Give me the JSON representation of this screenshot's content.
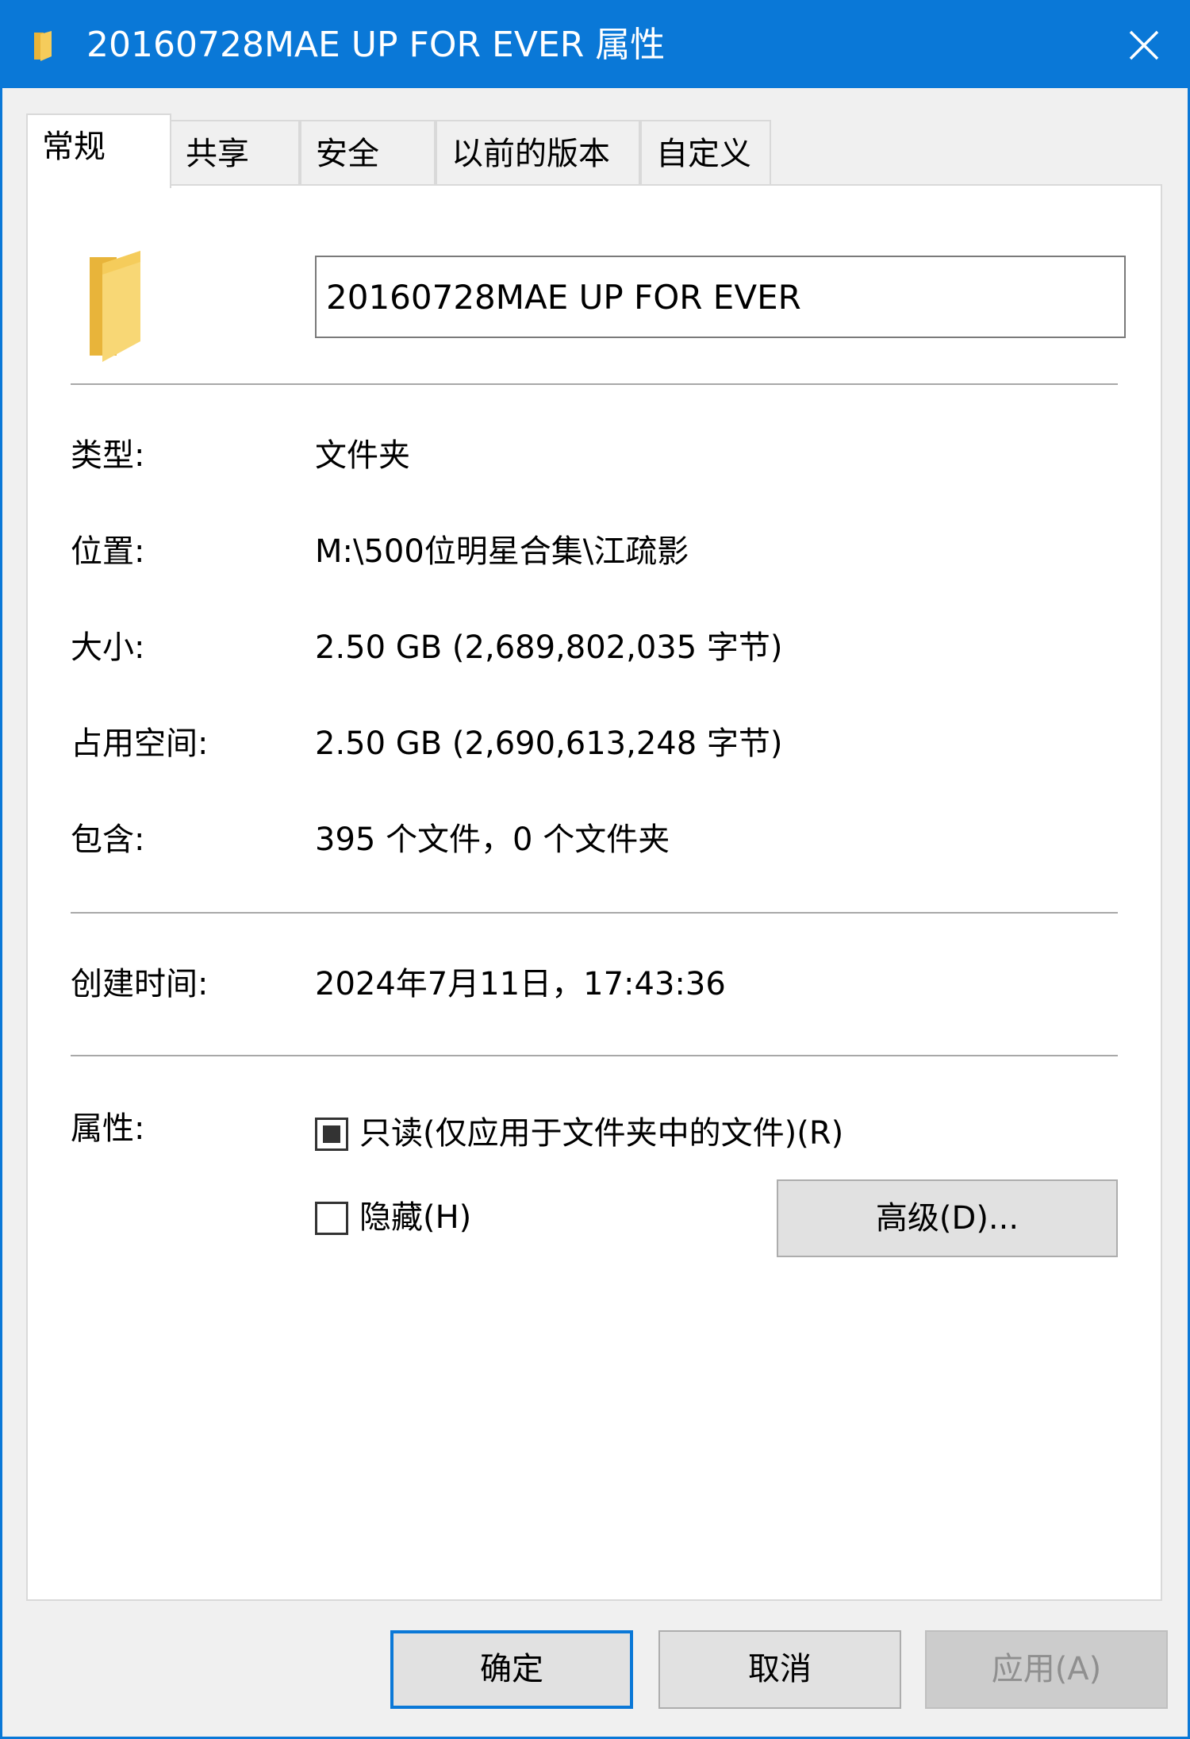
{
  "window": {
    "title": "20160728MAE UP FOR EVER 属性"
  },
  "tabs": [
    {
      "label": "常规",
      "active": true
    },
    {
      "label": "共享",
      "active": false
    },
    {
      "label": "安全",
      "active": false
    },
    {
      "label": "以前的版本",
      "active": false
    },
    {
      "label": "自定义",
      "active": false
    }
  ],
  "general": {
    "name_value": "20160728MAE UP FOR EVER",
    "rows": [
      {
        "label": "类型:",
        "value": "文件夹"
      },
      {
        "label": "位置:",
        "value": "M:\\500位明星合集\\江疏影"
      },
      {
        "label": "大小:",
        "value": "2.50 GB (2,689,802,035 字节)"
      },
      {
        "label": "占用空间:",
        "value": "2.50 GB (2,690,613,248 字节)"
      },
      {
        "label": "包含:",
        "value": "395 个文件，0 个文件夹"
      }
    ],
    "created": {
      "label": "创建时间:",
      "value": "2024年7月11日，17:43:36"
    },
    "attributes": {
      "label": "属性:",
      "readonly_label": "只读(仅应用于文件夹中的文件)(R)",
      "readonly_state": "indeterminate",
      "hidden_label": "隐藏(H)",
      "hidden_checked": false,
      "advanced_button": "高级(D)..."
    }
  },
  "buttons": {
    "ok": "确定",
    "cancel": "取消",
    "apply": "应用(A)"
  },
  "colors": {
    "titlebar": "#0a78d7",
    "folder": "#f5cc5b"
  },
  "icons": {
    "title": "folder-icon",
    "close": "close-icon",
    "large": "folder-icon"
  }
}
